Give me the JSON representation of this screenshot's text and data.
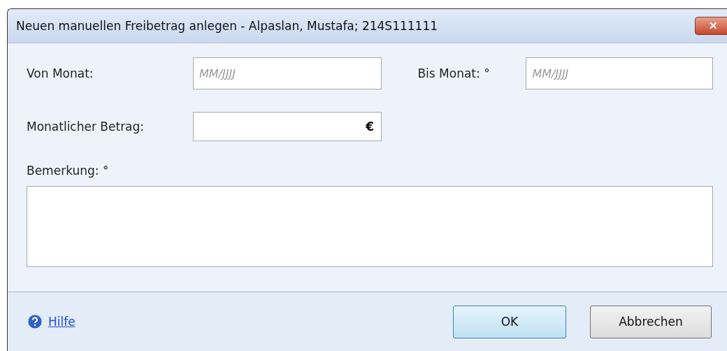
{
  "window": {
    "title": "Neuen manuellen Freibetrag anlegen - Alpaslan, Mustafa; 214S111111",
    "close": "✕"
  },
  "fields": {
    "von": {
      "label": "Von Monat:",
      "placeholder": "MM/JJJJ"
    },
    "bis": {
      "label": "Bis Monat: °",
      "placeholder": "MM/JJJJ"
    },
    "betrag": {
      "label": "Monatlicher Betrag:",
      "suffix": "€"
    },
    "bemerkung": {
      "label": "Bemerkung: °"
    }
  },
  "footer": {
    "help": "Hilfe",
    "buttons": [
      {
        "label": "OK",
        "default": true
      },
      {
        "label": "Abbrechen",
        "default": false
      }
    ]
  }
}
